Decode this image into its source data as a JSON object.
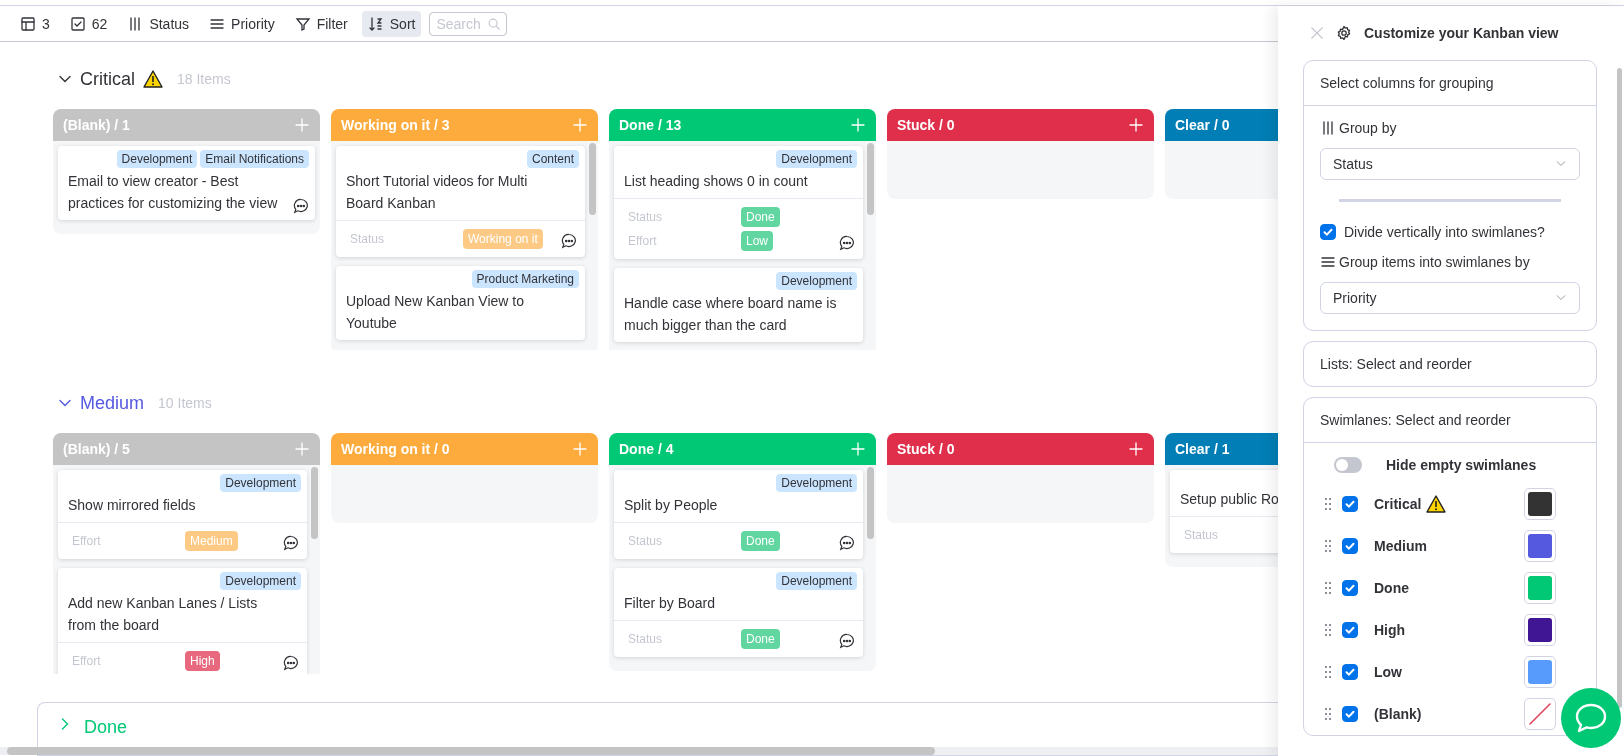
{
  "toolbar": [
    {
      "kind": "boards",
      "label": "3",
      "selected": false
    },
    {
      "kind": "items",
      "label": "62",
      "selected": false
    },
    {
      "kind": "group",
      "label": "Status",
      "selected": false
    },
    {
      "kind": "swimlane",
      "label": "Priority",
      "selected": false
    },
    {
      "kind": "filter",
      "label": "Filter",
      "selected": false
    },
    {
      "kind": "sort",
      "label": "Sort",
      "selected": true
    }
  ],
  "search": {
    "placeholder": "Search"
  },
  "lanes": [
    {
      "title": "Critical",
      "warning": true,
      "color": "#323338",
      "count": "18 Items",
      "expanded": true,
      "columns": [
        {
          "title": "(Blank) / 1",
          "color": "#c4c4c4",
          "add_button": true,
          "cards": [
            {
              "tags": [
                "Development",
                "Email Notifications"
              ],
              "title": "Email to view creator - Best practices for customizing the view",
              "has_comments": true
            }
          ]
        },
        {
          "title": "Working on it / 3",
          "color": "#fdab3d",
          "add_button": true,
          "cards": [
            {
              "tags": [
                "Content"
              ],
              "title": "Short Tutorial videos for Multi Board Kanban",
              "has_comments": true,
              "fields": [
                {
                  "label": "Status",
                  "value": "Working on it",
                  "color": "#fdca86"
                }
              ]
            },
            {
              "tags": [
                "Product Marketing"
              ],
              "title": "Upload New Kanban View to Youtube",
              "has_comments": false
            }
          ]
        },
        {
          "title": "Done / 13",
          "color": "#00c875",
          "add_button": true,
          "cards": [
            {
              "tags": [
                "Development"
              ],
              "title": "List heading shows 0 in count",
              "has_comments": true,
              "fields": [
                {
                  "label": "Status",
                  "value": "Done",
                  "color": "#62d6a1"
                },
                {
                  "label": "Effort",
                  "value": "Low",
                  "color": "#62d6a1"
                }
              ]
            },
            {
              "tags": [
                "Development"
              ],
              "title": "Handle case where board name is much bigger than the card",
              "has_comments": false
            }
          ]
        },
        {
          "title": "Stuck / 0",
          "color": "#df2f4a",
          "add_button": true
        },
        {
          "title": "Clear / 0",
          "color": "#007eb5",
          "add_button": false
        }
      ]
    },
    {
      "title": "Medium",
      "warning": false,
      "color": "#5559df",
      "count": "10 Items",
      "expanded": true,
      "columns": [
        {
          "title": "(Blank) / 5",
          "color": "#c4c4c4",
          "add_button": true,
          "cards": [
            {
              "tags": [
                "Development"
              ],
              "title": "Show mirrored fields",
              "has_comments": true,
              "fields": [
                {
                  "label": "Effort",
                  "value": "Medium",
                  "color": "#fdca86"
                }
              ]
            },
            {
              "tags": [
                "Development"
              ],
              "title": "Add new Kanban Lanes / Lists from the board",
              "has_comments": true,
              "fields": [
                {
                  "label": "Effort",
                  "value": "High",
                  "color": "#e8697d"
                }
              ]
            }
          ]
        },
        {
          "title": "Working on it / 0",
          "color": "#fdab3d",
          "add_button": true
        },
        {
          "title": "Done / 4",
          "color": "#00c875",
          "add_button": true,
          "cards": [
            {
              "tags": [
                "Development"
              ],
              "title": "Split by People",
              "has_comments": true,
              "fields": [
                {
                  "label": "Status",
                  "value": "Done",
                  "color": "#62d6a1"
                }
              ]
            },
            {
              "tags": [
                "Development"
              ],
              "title": "Filter by Board",
              "has_comments": true,
              "fields": [
                {
                  "label": "Status",
                  "value": "Done",
                  "color": "#62d6a1"
                }
              ]
            }
          ]
        },
        {
          "title": "Stuck / 0",
          "color": "#df2f4a",
          "add_button": true
        },
        {
          "title": "Clear / 1",
          "color": "#007eb5",
          "add_button": false,
          "cards": [
            {
              "title": "Setup public Ro",
              "has_comments": false,
              "fields": [
                {
                  "label": "Status"
                }
              ]
            }
          ]
        }
      ]
    },
    {
      "title": "Done",
      "warning": false,
      "color": "#00c875",
      "expanded": false
    }
  ],
  "panel": {
    "title": "Customize your Kanban view",
    "grouping": {
      "heading": "Select columns for grouping",
      "group_by_label": "Group by",
      "group_by_value": "Status",
      "divide": {
        "label": "Divide vertically into swimlanes?",
        "checked": true
      },
      "swimlane_label": "Group items into swimlanes by",
      "swimlane_value": "Priority"
    },
    "lists": {
      "heading": "Lists: Select and reorder"
    },
    "swimlanes": {
      "heading": "Swimlanes: Select and reorder",
      "hide_empty": {
        "label": "Hide empty swimlanes",
        "on": false
      },
      "items": [
        {
          "name": "Critical",
          "warning": true,
          "checked": true,
          "color": "#333333"
        },
        {
          "name": "Medium",
          "warning": false,
          "checked": true,
          "color": "#5559df"
        },
        {
          "name": "Done",
          "warning": false,
          "checked": true,
          "color": "#00c875"
        },
        {
          "name": "High",
          "warning": false,
          "checked": true,
          "color": "#401694"
        },
        {
          "name": "Low",
          "warning": false,
          "checked": true,
          "color": "#579bfc"
        },
        {
          "name": "(Blank)",
          "warning": false,
          "checked": true
        }
      ]
    }
  }
}
